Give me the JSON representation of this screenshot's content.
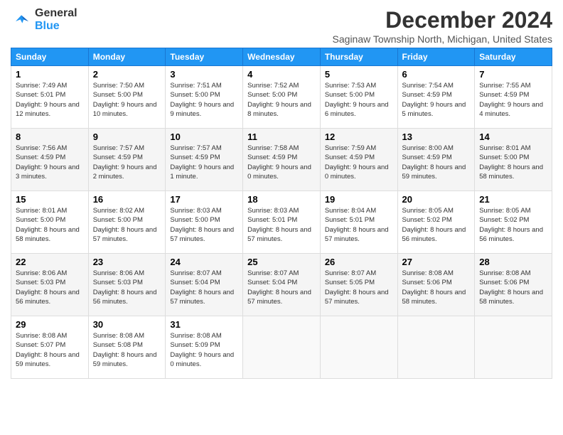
{
  "logo": {
    "text_general": "General",
    "text_blue": "Blue"
  },
  "title": "December 2024",
  "location": "Saginaw Township North, Michigan, United States",
  "days_header": [
    "Sunday",
    "Monday",
    "Tuesday",
    "Wednesday",
    "Thursday",
    "Friday",
    "Saturday"
  ],
  "weeks": [
    [
      {
        "day": "1",
        "sunrise": "7:49 AM",
        "sunset": "5:01 PM",
        "daylight": "9 hours and 12 minutes."
      },
      {
        "day": "2",
        "sunrise": "7:50 AM",
        "sunset": "5:00 PM",
        "daylight": "9 hours and 10 minutes."
      },
      {
        "day": "3",
        "sunrise": "7:51 AM",
        "sunset": "5:00 PM",
        "daylight": "9 hours and 9 minutes."
      },
      {
        "day": "4",
        "sunrise": "7:52 AM",
        "sunset": "5:00 PM",
        "daylight": "9 hours and 8 minutes."
      },
      {
        "day": "5",
        "sunrise": "7:53 AM",
        "sunset": "5:00 PM",
        "daylight": "9 hours and 6 minutes."
      },
      {
        "day": "6",
        "sunrise": "7:54 AM",
        "sunset": "4:59 PM",
        "daylight": "9 hours and 5 minutes."
      },
      {
        "day": "7",
        "sunrise": "7:55 AM",
        "sunset": "4:59 PM",
        "daylight": "9 hours and 4 minutes."
      }
    ],
    [
      {
        "day": "8",
        "sunrise": "7:56 AM",
        "sunset": "4:59 PM",
        "daylight": "9 hours and 3 minutes."
      },
      {
        "day": "9",
        "sunrise": "7:57 AM",
        "sunset": "4:59 PM",
        "daylight": "9 hours and 2 minutes."
      },
      {
        "day": "10",
        "sunrise": "7:57 AM",
        "sunset": "4:59 PM",
        "daylight": "9 hours and 1 minute."
      },
      {
        "day": "11",
        "sunrise": "7:58 AM",
        "sunset": "4:59 PM",
        "daylight": "9 hours and 0 minutes."
      },
      {
        "day": "12",
        "sunrise": "7:59 AM",
        "sunset": "4:59 PM",
        "daylight": "9 hours and 0 minutes."
      },
      {
        "day": "13",
        "sunrise": "8:00 AM",
        "sunset": "4:59 PM",
        "daylight": "8 hours and 59 minutes."
      },
      {
        "day": "14",
        "sunrise": "8:01 AM",
        "sunset": "5:00 PM",
        "daylight": "8 hours and 58 minutes."
      }
    ],
    [
      {
        "day": "15",
        "sunrise": "8:01 AM",
        "sunset": "5:00 PM",
        "daylight": "8 hours and 58 minutes."
      },
      {
        "day": "16",
        "sunrise": "8:02 AM",
        "sunset": "5:00 PM",
        "daylight": "8 hours and 57 minutes."
      },
      {
        "day": "17",
        "sunrise": "8:03 AM",
        "sunset": "5:00 PM",
        "daylight": "8 hours and 57 minutes."
      },
      {
        "day": "18",
        "sunrise": "8:03 AM",
        "sunset": "5:01 PM",
        "daylight": "8 hours and 57 minutes."
      },
      {
        "day": "19",
        "sunrise": "8:04 AM",
        "sunset": "5:01 PM",
        "daylight": "8 hours and 57 minutes."
      },
      {
        "day": "20",
        "sunrise": "8:05 AM",
        "sunset": "5:02 PM",
        "daylight": "8 hours and 56 minutes."
      },
      {
        "day": "21",
        "sunrise": "8:05 AM",
        "sunset": "5:02 PM",
        "daylight": "8 hours and 56 minutes."
      }
    ],
    [
      {
        "day": "22",
        "sunrise": "8:06 AM",
        "sunset": "5:03 PM",
        "daylight": "8 hours and 56 minutes."
      },
      {
        "day": "23",
        "sunrise": "8:06 AM",
        "sunset": "5:03 PM",
        "daylight": "8 hours and 56 minutes."
      },
      {
        "day": "24",
        "sunrise": "8:07 AM",
        "sunset": "5:04 PM",
        "daylight": "8 hours and 57 minutes."
      },
      {
        "day": "25",
        "sunrise": "8:07 AM",
        "sunset": "5:04 PM",
        "daylight": "8 hours and 57 minutes."
      },
      {
        "day": "26",
        "sunrise": "8:07 AM",
        "sunset": "5:05 PM",
        "daylight": "8 hours and 57 minutes."
      },
      {
        "day": "27",
        "sunrise": "8:08 AM",
        "sunset": "5:06 PM",
        "daylight": "8 hours and 58 minutes."
      },
      {
        "day": "28",
        "sunrise": "8:08 AM",
        "sunset": "5:06 PM",
        "daylight": "8 hours and 58 minutes."
      }
    ],
    [
      {
        "day": "29",
        "sunrise": "8:08 AM",
        "sunset": "5:07 PM",
        "daylight": "8 hours and 59 minutes."
      },
      {
        "day": "30",
        "sunrise": "8:08 AM",
        "sunset": "5:08 PM",
        "daylight": "8 hours and 59 minutes."
      },
      {
        "day": "31",
        "sunrise": "8:08 AM",
        "sunset": "5:09 PM",
        "daylight": "9 hours and 0 minutes."
      },
      null,
      null,
      null,
      null
    ]
  ]
}
